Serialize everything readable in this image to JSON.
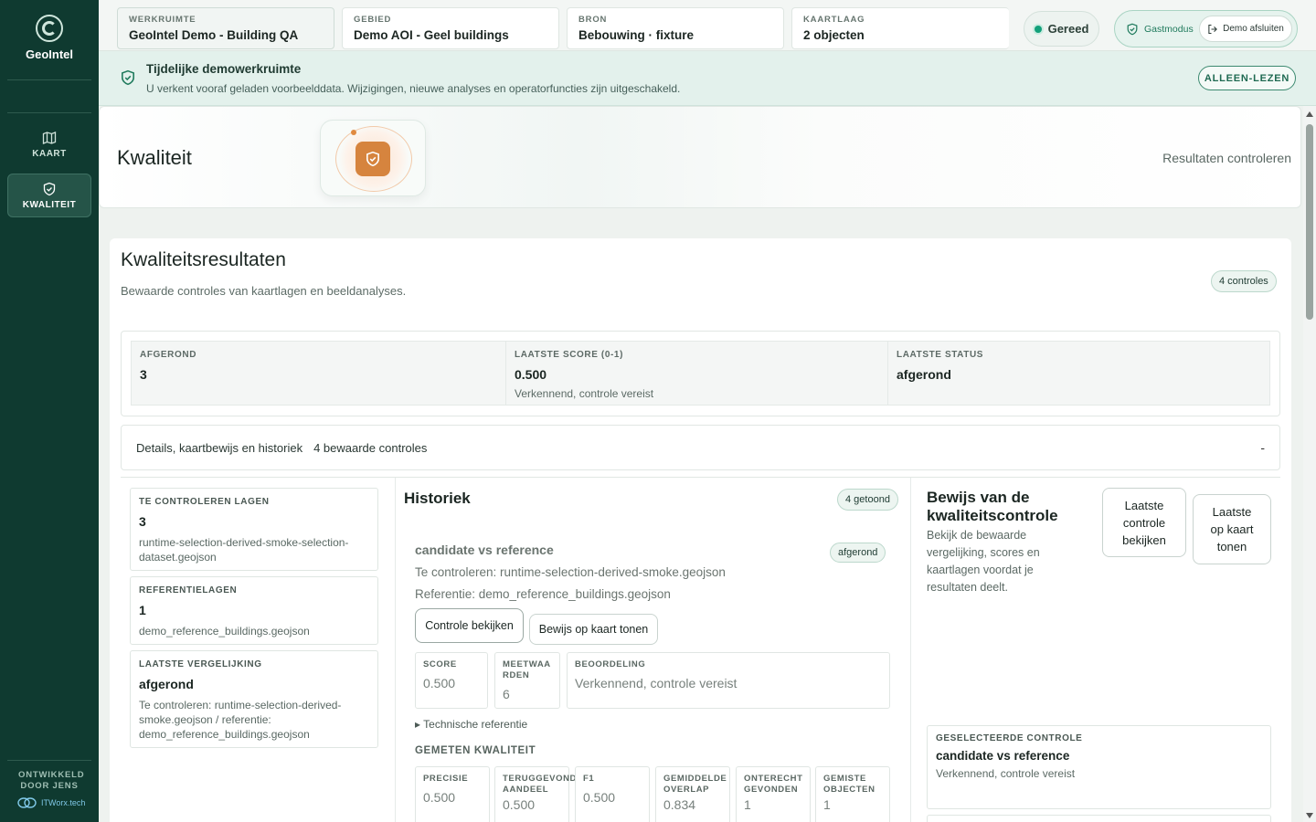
{
  "sidebar": {
    "brand": "GeoIntel",
    "nav": [
      {
        "label": "KAART",
        "icon": "map-icon"
      },
      {
        "label": "KWALITEIT",
        "icon": "shield-check-icon"
      }
    ],
    "developed_by": "ONTWIKKELD DOOR JENS",
    "partner": "ITWorx.tech"
  },
  "topbar": {
    "chips": [
      {
        "label": "WERKRUIMTE",
        "value": "GeoIntel Demo - Building QA"
      },
      {
        "label": "GEBIED",
        "value": "Demo AOI - Geel buildings"
      },
      {
        "label": "BRON",
        "value": "Bebouwing · fixture"
      },
      {
        "label": "KAARTLAAG",
        "value": "2 objecten"
      }
    ],
    "status": "Gereed",
    "guest_mode": "Gastmodus",
    "end_demo": "Demo afsluiten"
  },
  "banner": {
    "title": "Tijdelijke demowerkruimte",
    "text": "U verkent vooraf geladen voorbeelddata. Wijzigingen, nieuwe analyses en operatorfuncties zijn uitgeschakeld.",
    "readonly": "ALLEEN-LEZEN"
  },
  "hero": {
    "title": "Kwaliteit",
    "right": "Resultaten controleren"
  },
  "results": {
    "title": "Kwaliteitsresultaten",
    "subtitle": "Bewaarde controles van kaartlagen en beeldanalyses.",
    "count_badge": "4 controles",
    "stats": [
      {
        "label": "AFGEROND",
        "value": "3",
        "note": ""
      },
      {
        "label": "LAATSTE SCORE (0-1)",
        "value": "0.500",
        "note": "Verkennend, controle vereist"
      },
      {
        "label": "LAATSTE STATUS",
        "value": "afgerond",
        "note": ""
      }
    ],
    "details_label": "Details, kaartbewijs en historiek",
    "details_count": "4 bewaarde controles",
    "details_toggle": "-"
  },
  "left_cards": [
    {
      "label": "TE CONTROLEREN LAGEN",
      "value": "3",
      "note": "runtime-selection-derived-smoke-selection-dataset.geojson"
    },
    {
      "label": "REFERENTIELAGEN",
      "value": "1",
      "note": "demo_reference_buildings.geojson"
    },
    {
      "label": "LAATSTE VERGELIJKING",
      "value": "afgerond",
      "note": "Te controleren: runtime-selection-derived-smoke.geojson / referentie: demo_reference_buildings.geojson"
    }
  ],
  "history": {
    "title": "Historiek",
    "shown": "4 getoond",
    "entry": {
      "title": "candidate vs reference",
      "status": "afgerond",
      "candidate": "Te controleren: runtime-selection-derived-smoke.geojson",
      "reference": "Referentie: demo_reference_buildings.geojson",
      "btn_view": "Controle bekijken",
      "btn_map": "Bewijs op kaart tonen",
      "score_label": "SCORE",
      "score": "0.500",
      "measure_label": "MEETWAARDEN",
      "measure": "6",
      "rating_label": "BEOORDELING",
      "rating": "Verkennend, controle vereist",
      "tech_ref": "▸ Technische referentie",
      "measured_title": "GEMETEN KWALITEIT",
      "metrics": [
        {
          "label": "PRECISIE",
          "value": "0.500"
        },
        {
          "label": "TERUGGEVONDEN AANDEEL",
          "value": "0.500"
        },
        {
          "label": "F1",
          "value": "0.500"
        },
        {
          "label": "GEMIDDELDE OVERLAP",
          "value": "0.834"
        },
        {
          "label": "ONTERECHT GEVONDEN",
          "value": "1"
        },
        {
          "label": "GEMISTE OBJECTEN",
          "value": "1"
        }
      ]
    }
  },
  "evidence": {
    "title": "Bewijs van de kwaliteitscontrole",
    "text": "Bekijk de bewaarde vergelijking, scores en kaartlagen voordat je resultaten deelt.",
    "btn_latest": "Laatste controle bekijken",
    "btn_map": "Laatste op kaart tonen",
    "selected_label": "GESELECTEERDE CONTROLE",
    "selected_value": "candidate vs reference",
    "selected_note": "Verkennend, controle vereist"
  }
}
